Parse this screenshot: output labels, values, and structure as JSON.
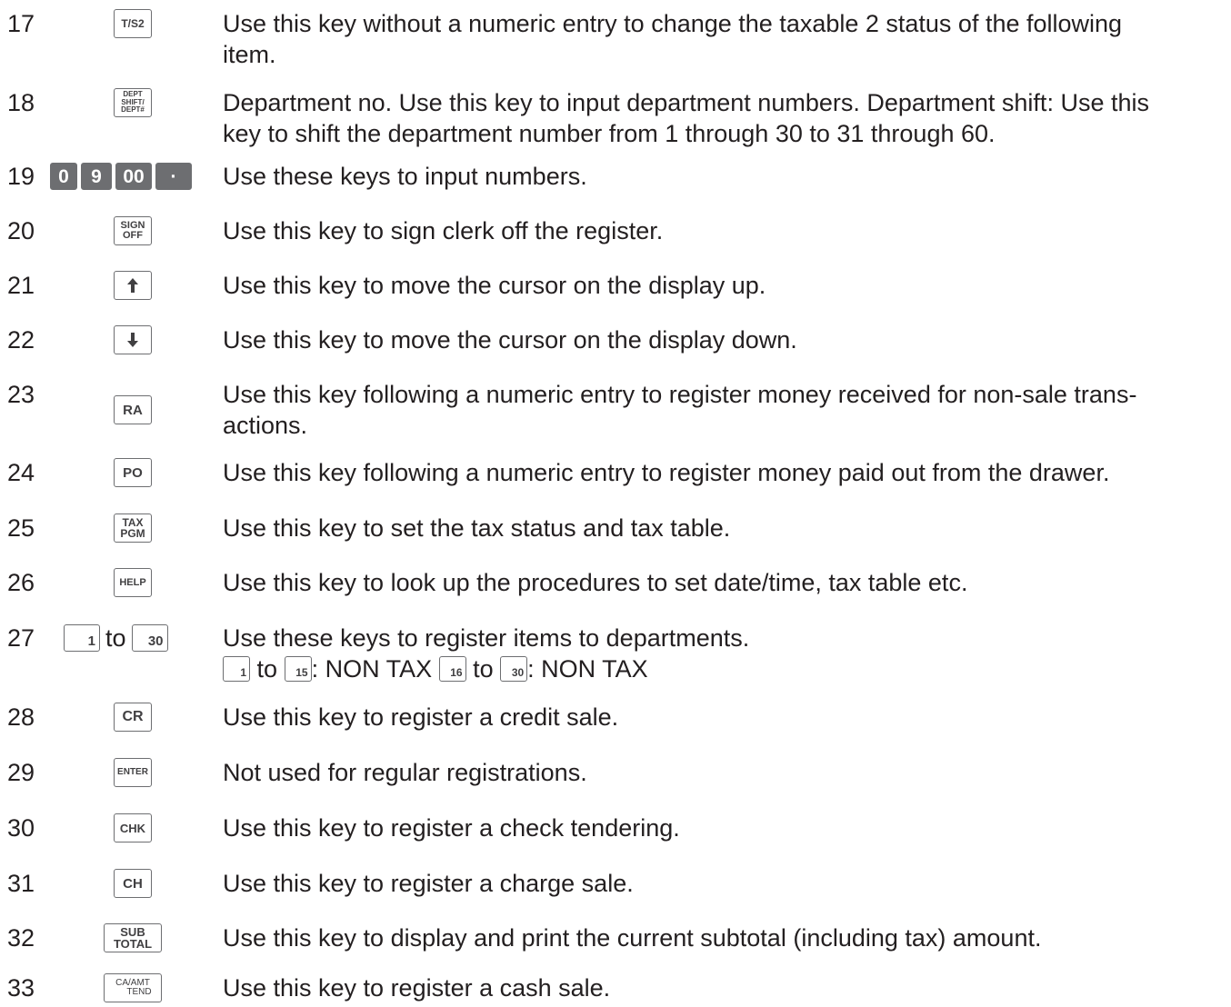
{
  "rows": [
    {
      "num": "17",
      "key": [
        "T/S2"
      ],
      "lines": [
        "Use this key without a numeric entry to change the taxable 2 status of the following",
        "item."
      ]
    },
    {
      "num": "18",
      "key": [
        "DEPT",
        "SHIFT/",
        "DEPT#"
      ],
      "lines": [
        "Department no. Use this key to input department numbers. Department shift: Use this",
        "key to shift the department number from 1 through 30 to 31 through 60."
      ]
    },
    {
      "num": "19",
      "key": [
        "0",
        "9",
        "00",
        "·"
      ],
      "lines": [
        "Use these keys to input numbers."
      ]
    },
    {
      "num": "20",
      "key": [
        "SIGN",
        "OFF"
      ],
      "lines": [
        "Use this key to sign clerk off the register."
      ]
    },
    {
      "num": "21",
      "key": [
        "up-arrow"
      ],
      "lines": [
        "Use this key to move the cursor on the display up."
      ]
    },
    {
      "num": "22",
      "key": [
        "down-arrow"
      ],
      "lines": [
        "Use this key to move the cursor on the display down."
      ]
    },
    {
      "num": "23",
      "key": [
        "RA"
      ],
      "lines": [
        "Use this key following a numeric entry to register money received for non-sale trans-",
        "actions."
      ]
    },
    {
      "num": "24",
      "key": [
        "PO"
      ],
      "lines": [
        "Use this key following a numeric entry to register money paid out from the drawer."
      ]
    },
    {
      "num": "25",
      "key": [
        "TAX",
        "PGM"
      ],
      "lines": [
        "Use this key to set the tax status and tax table."
      ]
    },
    {
      "num": "26",
      "key": [
        "HELP"
      ],
      "lines": [
        "Use this key to look up the procedures to set date/time, tax table etc."
      ]
    },
    {
      "num": "27",
      "key": [
        "1",
        "to",
        "30"
      ],
      "lines": [
        "Use these keys to register items to departments."
      ],
      "subline": {
        "k1": "1",
        "to1": "to",
        "k2": "15",
        "t1": ": NON TAX",
        "k3": "16",
        "to2": "to",
        "k4": "30",
        "t2": ": NON TAX"
      }
    },
    {
      "num": "28",
      "key": [
        "CR"
      ],
      "lines": [
        "Use this key to register a credit sale."
      ]
    },
    {
      "num": "29",
      "key": [
        "ENTER"
      ],
      "lines": [
        "Not used for regular registrations."
      ]
    },
    {
      "num": "30",
      "key": [
        "CHK"
      ],
      "lines": [
        "Use this key to register a check tendering."
      ]
    },
    {
      "num": "31",
      "key": [
        "CH"
      ],
      "lines": [
        "Use this key to register a charge sale."
      ]
    },
    {
      "num": "32",
      "key": [
        "SUB",
        "TOTAL"
      ],
      "lines": [
        "Use this key to display and print the current subtotal (including tax) amount."
      ]
    },
    {
      "num": "33",
      "key": [
        "CA/AMT",
        "TEND"
      ],
      "lines": [
        "Use this key to register a cash sale."
      ]
    }
  ]
}
